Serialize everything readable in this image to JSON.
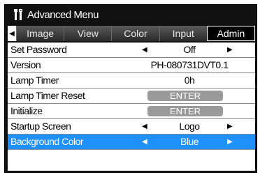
{
  "title": "Advanced Menu",
  "icons": {
    "title": "tools-icon",
    "tab_left": "left-arrow-icon",
    "value_left": "left-arrow-icon",
    "value_right": "right-arrow-icon"
  },
  "tabs": [
    {
      "label": "Image",
      "active": false
    },
    {
      "label": "View",
      "active": false
    },
    {
      "label": "Color",
      "active": false
    },
    {
      "label": "Input",
      "active": false
    },
    {
      "label": "Admin",
      "active": true
    }
  ],
  "rows": [
    {
      "label": "Set Password",
      "value": "Off",
      "type": "select"
    },
    {
      "label": "Version",
      "value": "PH-080731DVT0.1",
      "type": "text"
    },
    {
      "label": "Lamp Timer",
      "value": "0h",
      "type": "text"
    },
    {
      "label": "Lamp Timer Reset",
      "value": "ENTER",
      "type": "button"
    },
    {
      "label": "Initialize",
      "value": "ENTER",
      "type": "button"
    },
    {
      "label": "Startup Screen",
      "value": "Logo",
      "type": "select"
    },
    {
      "label": "Background Color",
      "value": "Blue",
      "type": "select",
      "selected": true
    }
  ],
  "colors": {
    "selected_row": "#1e90ff",
    "button_bg": "#9a9a9a",
    "frame_bg": "#111111"
  }
}
